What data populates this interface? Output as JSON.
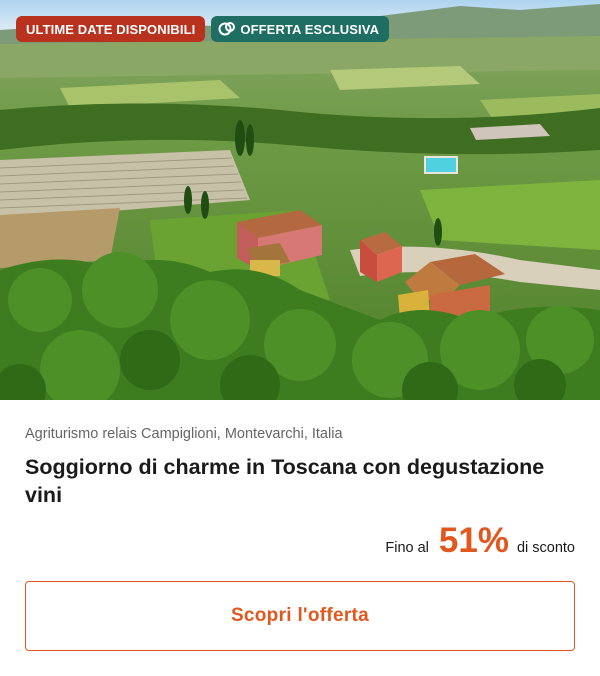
{
  "badges": {
    "availability": "ULTIME DATE DISPONIBILI",
    "exclusive": "OFFERTA ESCLUSIVA"
  },
  "colors": {
    "accent": "#e2571e",
    "badge_red": "#b8321e",
    "badge_teal": "#1f6e63"
  },
  "offer": {
    "location": "Agriturismo relais Campiglioni, Montevarchi, Italia",
    "title": "Soggiorno di charme in Toscana con degustazione vini",
    "discount_prefix": "Fino al",
    "discount_value": "51%",
    "discount_suffix": "di sconto",
    "cta_label": "Scopri l'offerta"
  },
  "image": {
    "icon": "aerial-photo-tuscan-villa"
  }
}
